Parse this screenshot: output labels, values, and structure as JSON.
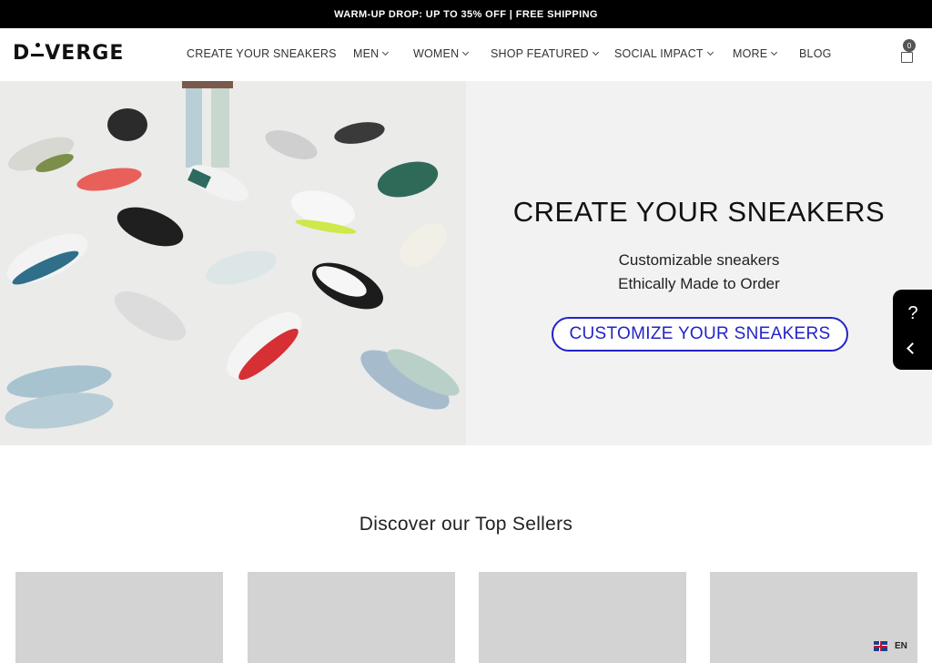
{
  "announcement": "WARM-UP DROP: UP TO 35% OFF | FREE SHIPPING",
  "logo": {
    "part1": "D",
    "part2": "VERGE"
  },
  "nav": [
    {
      "label": "CREATE YOUR SNEAKERS",
      "dropdown": false
    },
    {
      "label": "MEN",
      "dropdown": true
    },
    {
      "label": "WOMEN",
      "dropdown": true
    },
    {
      "label": "SHOP FEATURED",
      "dropdown": true
    },
    {
      "label": "SOCIAL IMPACT",
      "dropdown": true
    },
    {
      "label": "MORE",
      "dropdown": true
    },
    {
      "label": "BLOG",
      "dropdown": false
    }
  ],
  "cart": {
    "count": "0"
  },
  "hero": {
    "title": "CREATE YOUR SNEAKERS",
    "subtitle_1": "Customizable sneakers",
    "subtitle_2": "Ethically Made to Order",
    "button": "CUSTOMIZE YOUR SNEAKERS"
  },
  "top_sellers": {
    "title": "Discover our Top Sellers"
  },
  "language": "EN",
  "colors": {
    "accent": "#2323c8",
    "announcement_bg": "#000000",
    "card_placeholder": "#d3d3d3"
  }
}
